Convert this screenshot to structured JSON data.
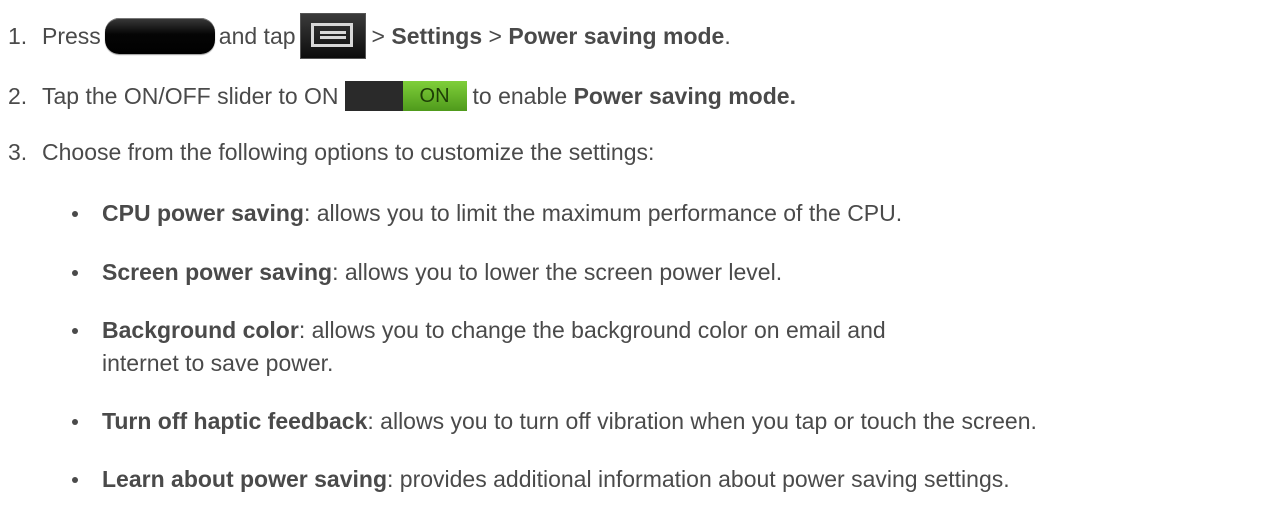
{
  "steps": [
    {
      "number": "1.",
      "press_text": "Press",
      "and_tap_text": "and tap",
      "sep1": ">",
      "settings_label": "Settings",
      "sep2": ">",
      "power_label": "Power saving mode",
      "end": ".",
      "home_icon": "home-key-icon",
      "menu_icon": "menu-key-icon"
    },
    {
      "number": "2.",
      "text_before": "Tap the ON/OFF slider to ON",
      "slider_label": "ON",
      "text_after": "to enable",
      "bold": "Power saving mode."
    },
    {
      "number": "3.",
      "text": "Choose from the following options to customize the settings:"
    }
  ],
  "options": [
    {
      "title": "CPU power saving",
      "desc": ": allows you to limit the maximum performance of the CPU."
    },
    {
      "title": "Screen power saving",
      "desc": ": allows you to lower the screen power level."
    },
    {
      "title": "Background color",
      "desc": ": allows you to change the background color on email and internet to save power."
    },
    {
      "title": "Turn off haptic feedback",
      "desc": ": allows you to turn off vibration when you tap or touch the screen."
    },
    {
      "title": "Learn about power saving",
      "desc": ": provides additional information about power saving settings."
    }
  ],
  "colors": {
    "text": "#4a4a4a",
    "slider_on": "#5fae24",
    "slider_off": "#2a2a2a"
  }
}
